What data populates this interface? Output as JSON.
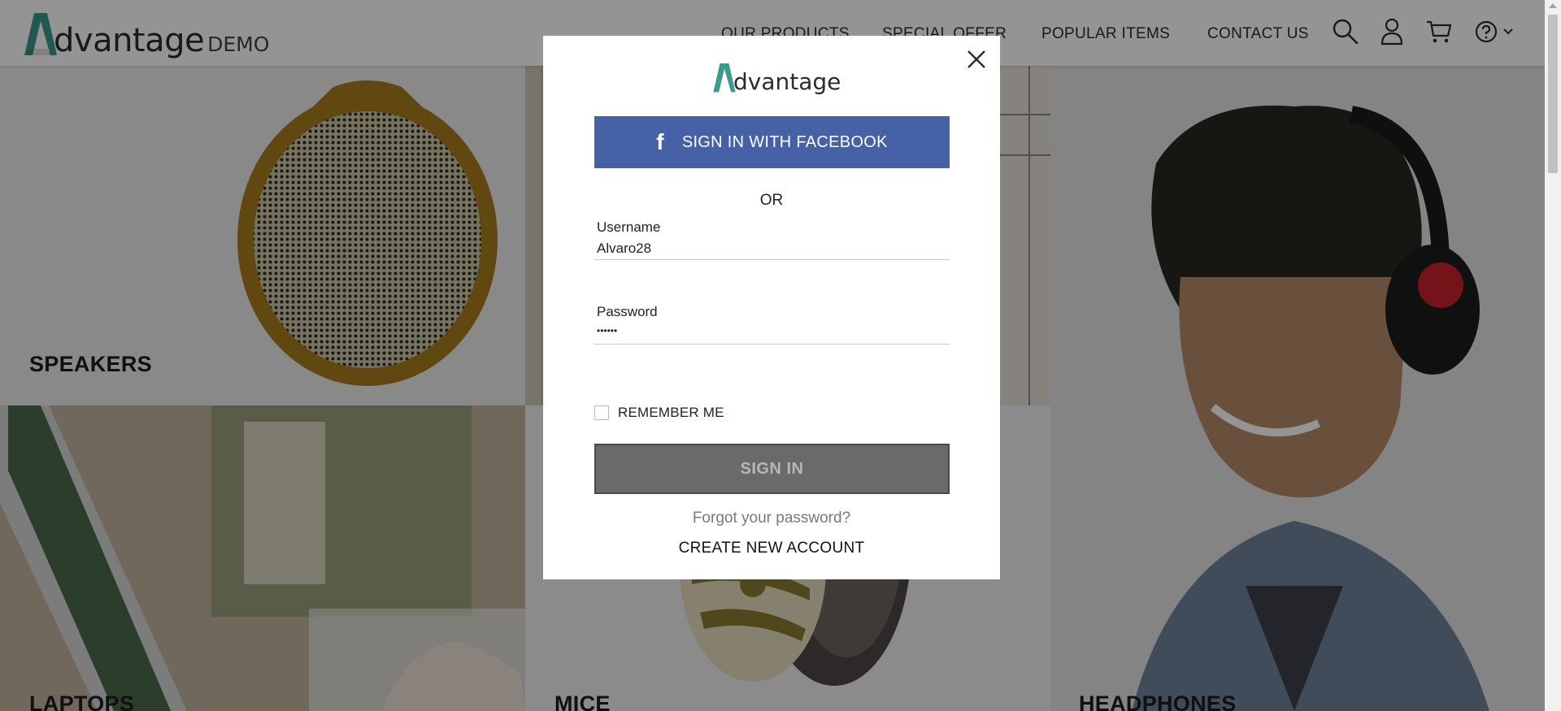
{
  "header": {
    "logo_text": "dvantage",
    "logo_suffix": "DEMO",
    "nav": [
      "OUR PRODUCTS",
      "SPECIAL OFFER",
      "POPULAR ITEMS",
      "CONTACT US"
    ],
    "icons": [
      "search-icon",
      "user-icon",
      "cart-icon",
      "help-icon",
      "chevron-down-icon"
    ]
  },
  "categories": [
    {
      "label": "SPEAKERS"
    },
    {
      "label": "LAPTOPS"
    },
    {
      "label": "MICE"
    },
    {
      "label": "HEADPHONES"
    }
  ],
  "login": {
    "logo_text": "dvantage",
    "facebook_label": "SIGN IN WITH FACEBOOK",
    "or_text": "OR",
    "username_label": "Username",
    "username_value": "Alvaro28",
    "password_label": "Password",
    "password_value": "••••••",
    "remember_label": "REMEMBER ME",
    "remember_checked": false,
    "signin_label": "SIGN IN",
    "forgot_label": "Forgot your password?",
    "create_label": "CREATE NEW ACCOUNT"
  },
  "colors": {
    "accent": "#3a9a8e",
    "facebook": "#4661a5",
    "signin_bg": "#6a6a6a"
  }
}
